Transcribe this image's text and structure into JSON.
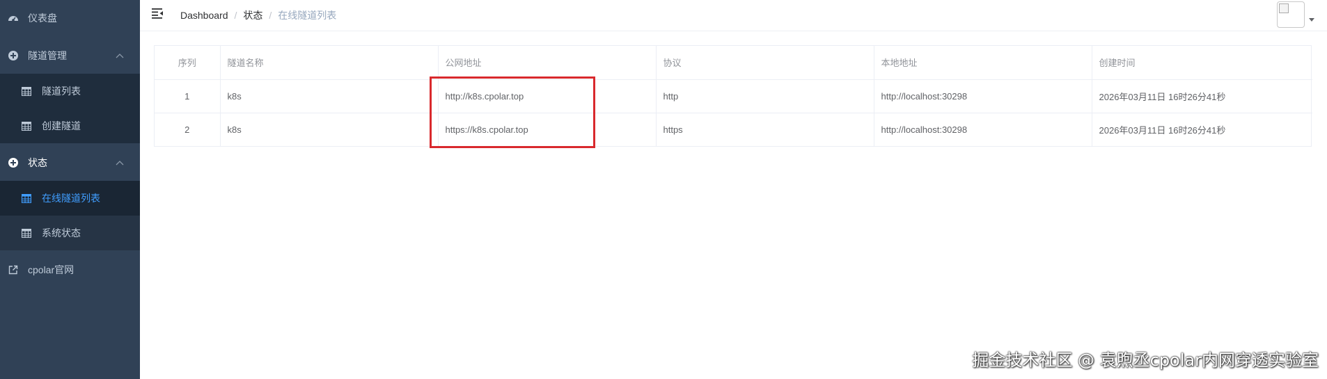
{
  "sidebar": {
    "dashboard_label": "仪表盘",
    "tunnel_mgmt_label": "隧道管理",
    "tunnel_list_label": "隧道列表",
    "create_tunnel_label": "创建隧道",
    "status_label": "状态",
    "online_tunnels_label": "在线隧道列表",
    "system_status_label": "系统状态",
    "cpolar_site_label": "cpolar官网"
  },
  "breadcrumb": {
    "home": "Dashboard",
    "sep1": "/",
    "level2": "状态",
    "sep2": "/",
    "current": "在线隧道列表"
  },
  "table": {
    "headers": [
      "序列",
      "隧道名称",
      "公网地址",
      "协议",
      "本地地址",
      "创建时间"
    ],
    "rows": [
      [
        "1",
        "k8s",
        "http://k8s.cpolar.top",
        "http",
        "http://localhost:30298",
        "2026年03月11日 16时26分41秒"
      ],
      [
        "2",
        "k8s",
        "https://k8s.cpolar.top",
        "https",
        "http://localhost:30298",
        "2026年03月11日 16时26分41秒"
      ]
    ]
  },
  "watermark": "掘金技术社区 @ 袁煦丞cpolar内网穿透实验室",
  "colors": {
    "sidebar_bg": "#304156",
    "submenu_bg": "#1f2d3d",
    "active_text": "#409eff",
    "highlight": "#d9292d"
  },
  "icons": {
    "dashboard": "dashboard-icon",
    "plus_circle": "plus-circle-icon",
    "table": "table-icon",
    "external_link": "external-link-icon",
    "hamburger": "hamburger-icon",
    "chevron_up": "chevron-up-icon",
    "caret_down": "caret-down-icon"
  }
}
